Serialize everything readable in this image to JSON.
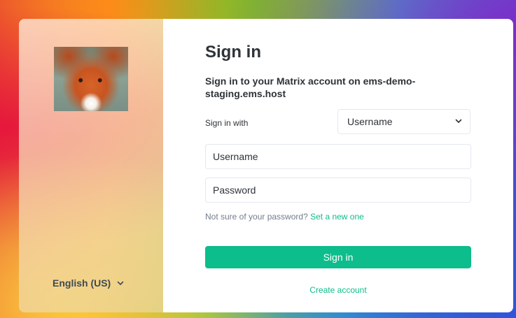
{
  "left_panel": {
    "language": "English (US)"
  },
  "form": {
    "title": "Sign in",
    "subtitle": "Sign in to your Matrix account on ems-demo-staging.ems.host",
    "sign_in_with_label": "Sign in with",
    "sign_in_with_value": "Username",
    "username_placeholder": "Username",
    "password_placeholder": "Password",
    "forgot_text": "Not sure of your password?",
    "forgot_link": "Set a new one",
    "sign_in_button": "Sign in",
    "create_account": "Create account"
  },
  "colors": {
    "accent": "#0dbd8b",
    "text_primary": "#2e3338",
    "text_secondary": "#737d8c",
    "border": "#e3e8f0"
  },
  "icons": {
    "language_dropdown": "chevron-down-icon",
    "sign_in_with_dropdown": "chevron-down-icon"
  }
}
